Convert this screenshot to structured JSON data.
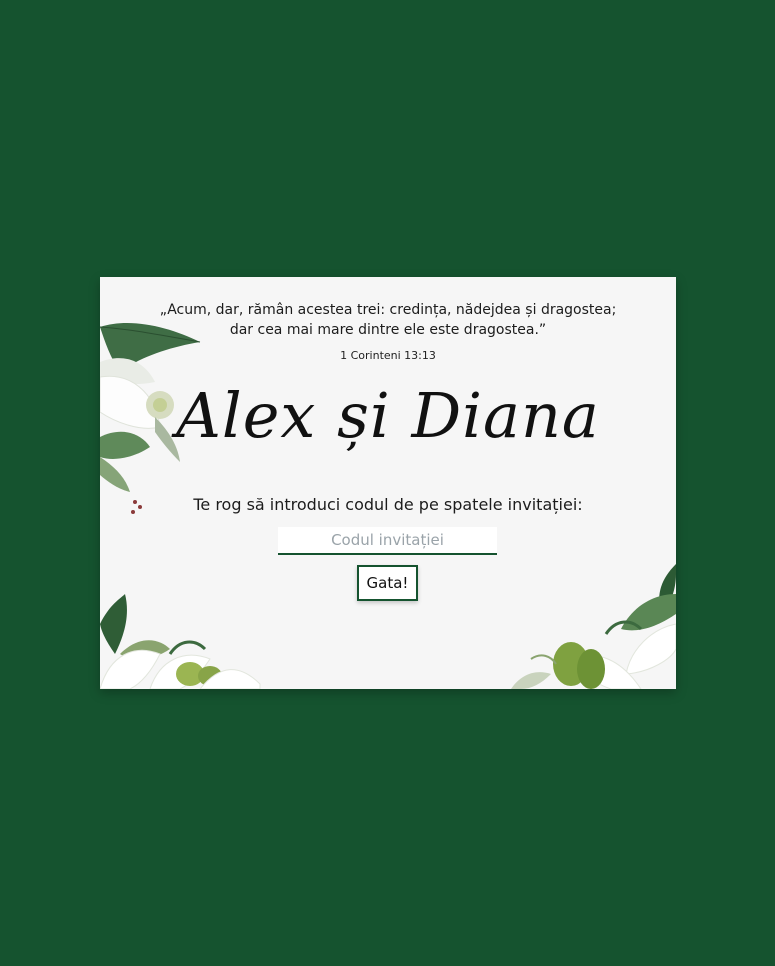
{
  "invitation": {
    "quote_line_1": "„Acum, dar, rămân acestea trei: credința, nădejdea și dragostea;",
    "quote_line_2": "dar cea mai mare dintre ele este dragostea.”",
    "reference": "1 Corinteni 13:13",
    "names": "Alex și Diana",
    "prompt": "Te rog să introduci codul de pe spatele invitației:",
    "code_input": {
      "value": "",
      "placeholder": "Codul invitației"
    },
    "submit_label": "Gata!"
  },
  "colors": {
    "background": "#15532f",
    "card": "#f6f6f6",
    "accent": "#15532f"
  },
  "decorations": [
    "leaf-floral-left",
    "lily-floral-bottom-left",
    "lily-floral-bottom-right"
  ]
}
